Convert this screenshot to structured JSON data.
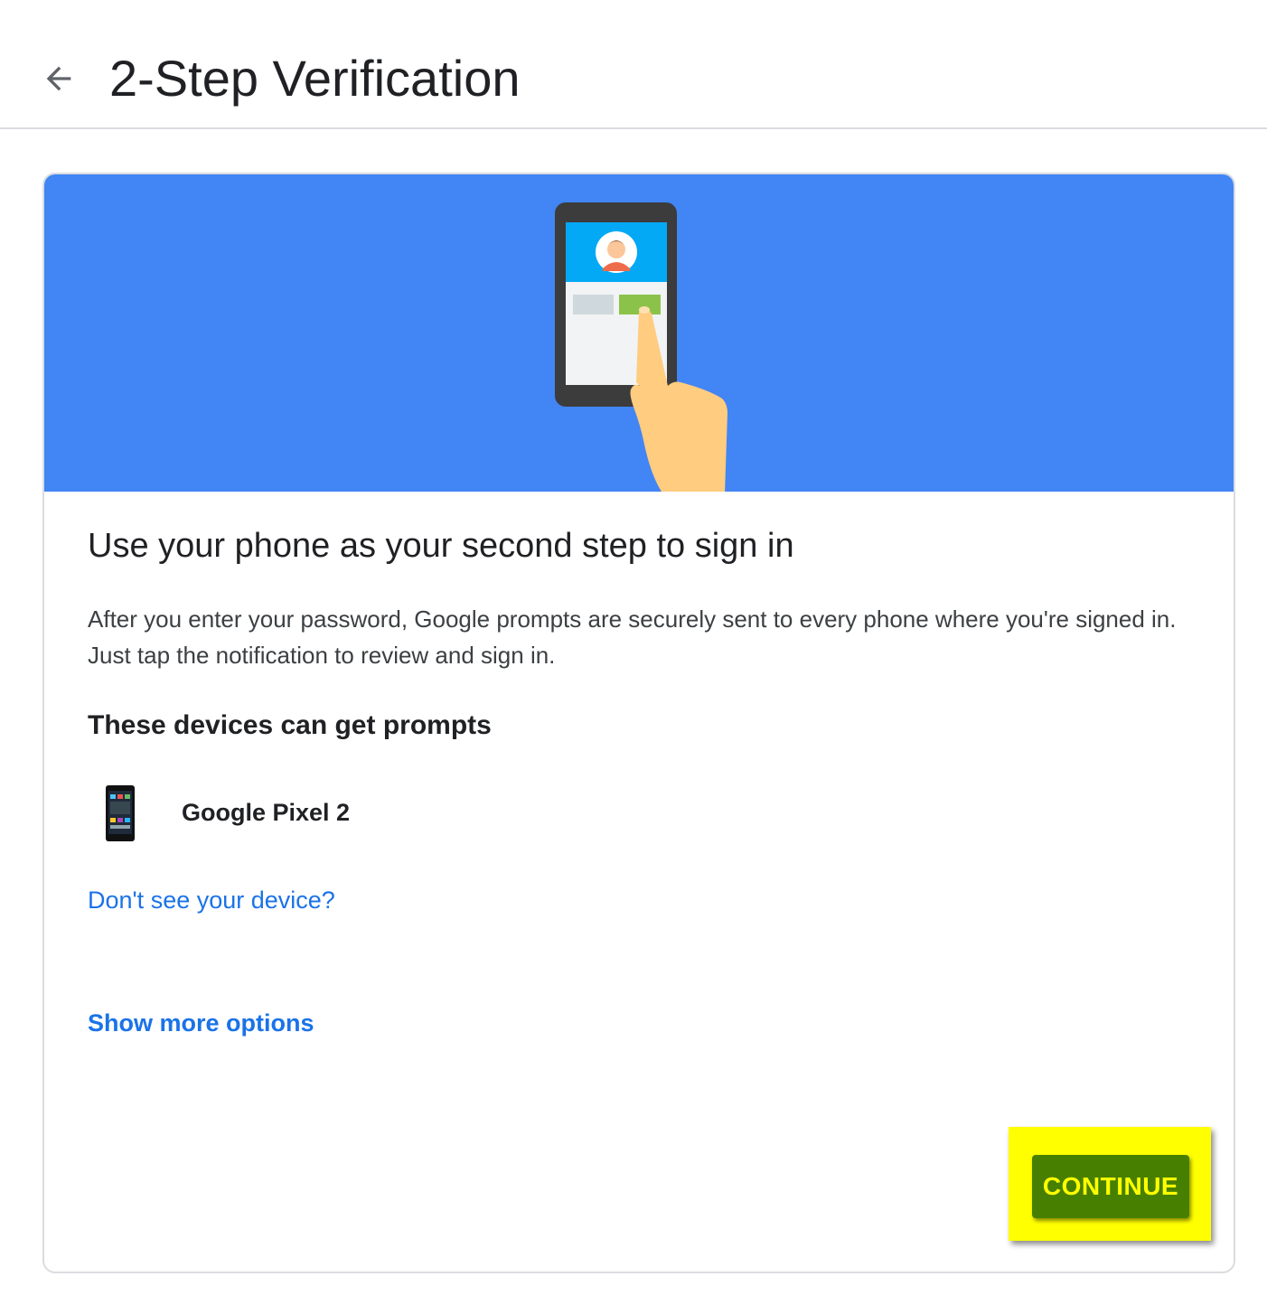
{
  "header": {
    "back_icon": "arrow-back-icon",
    "title": "2-Step Verification"
  },
  "card": {
    "hero_illustration": "phone-tap-prompt-illustration",
    "colors": {
      "hero_bg": "#4285f4",
      "link": "#1a73e8",
      "button_bg": "#478000",
      "button_text": "#ffff00",
      "highlight": "#ffff00"
    },
    "heading": "Use your phone as your second step to sign in",
    "description": "After you enter your password, Google prompts are securely sent to every phone where you're signed in. Just tap the notification to review and sign in.",
    "devices_heading": "These devices can get prompts",
    "devices": [
      {
        "icon": "smartphone-icon",
        "name": "Google Pixel 2"
      }
    ],
    "dont_see_link": "Don't see your device?",
    "more_options_link": "Show more options",
    "continue_label": "CONTINUE"
  }
}
